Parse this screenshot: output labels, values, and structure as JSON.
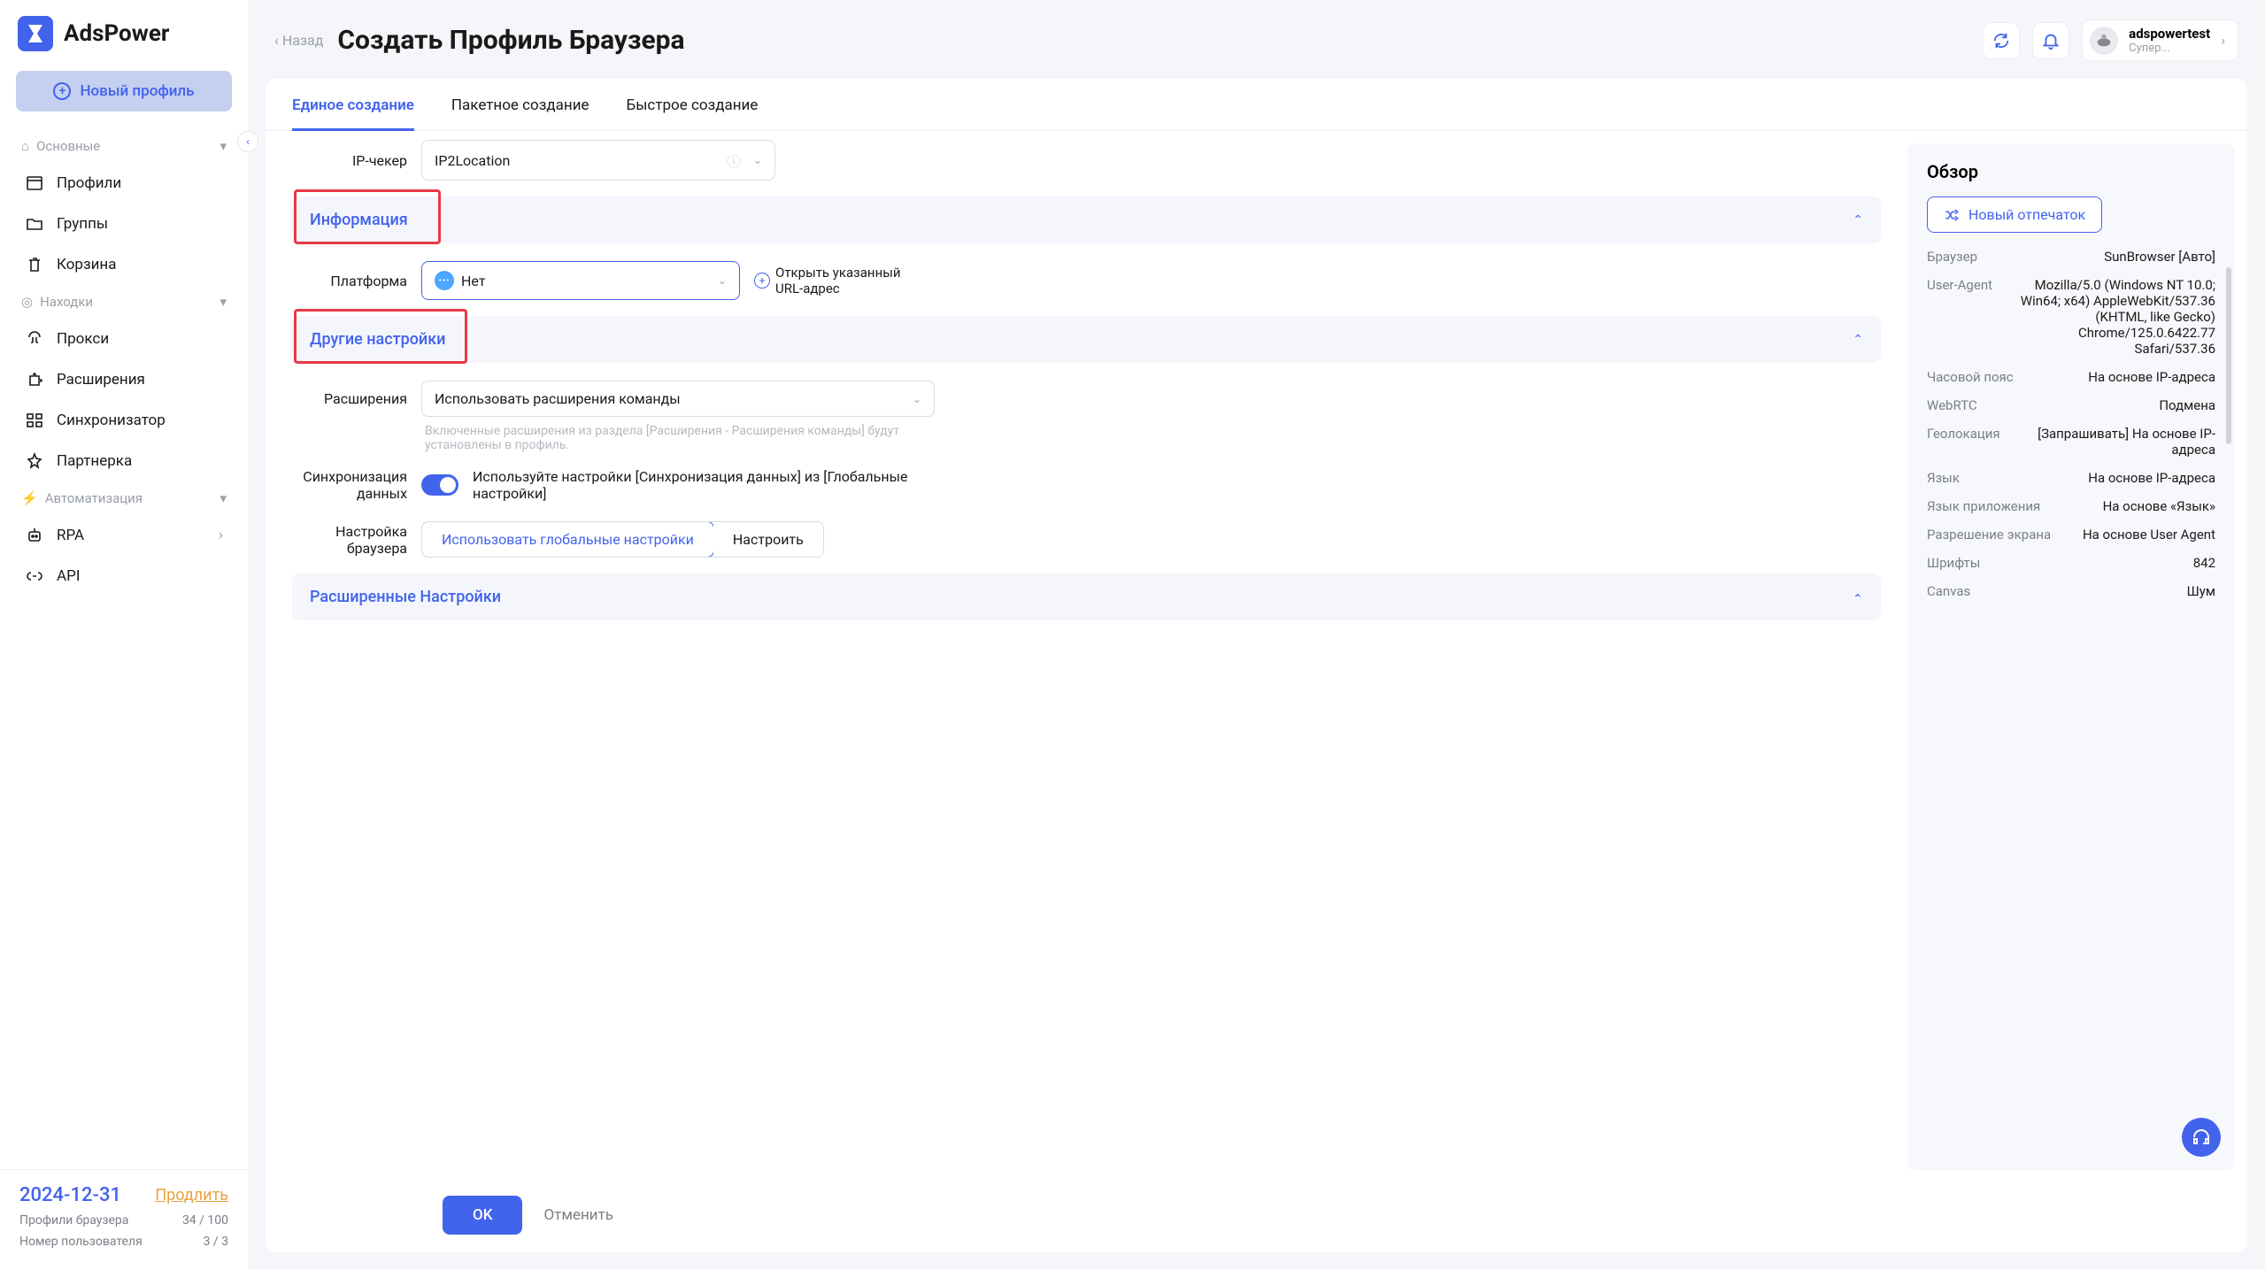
{
  "logo": {
    "text": "AdsPower"
  },
  "sidebar": {
    "new_profile": "Новый профиль",
    "sections": {
      "basic": {
        "label": "Основные",
        "items": [
          "Профили",
          "Группы",
          "Корзина"
        ]
      },
      "finds": {
        "label": "Находки",
        "items": [
          "Прокси",
          "Расширения",
          "Синхронизатор",
          "Партнерка"
        ]
      },
      "auto": {
        "label": "Автоматизация",
        "items": [
          "RPA",
          "API"
        ]
      }
    },
    "footer": {
      "date": "2024-12-31",
      "extend": "Продлить",
      "profiles_label": "Профили браузера",
      "profiles_value": "34 / 100",
      "users_label": "Номер пользователя",
      "users_value": "3 / 3"
    }
  },
  "header": {
    "back": "Назад",
    "title": "Создать Профиль Браузера",
    "user": {
      "name": "adspowertest",
      "role": "Супер..."
    }
  },
  "tabs": {
    "single": "Единое создание",
    "batch": "Пакетное создание",
    "quick": "Быстрое создание"
  },
  "form": {
    "ip_checker": {
      "label": "IP-чекер",
      "value": "IP2Location"
    },
    "section_info": "Информация",
    "platform": {
      "label": "Платформа",
      "value": "Нет",
      "open_url": "Открыть указанный URL-адрес"
    },
    "section_other": "Другие настройки",
    "extensions": {
      "label": "Расширения",
      "value": "Использовать расширения команды",
      "hint": "Включенные расширения из раздела [Расширения - Расширения команды] будут установлены в профиль."
    },
    "sync": {
      "label": "Синхронизация данных",
      "text": "Используйте настройки [Синхронизация данных] из [Глобальные настройки]"
    },
    "browser_settings": {
      "label": "Настройка браузера",
      "global": "Использовать глобальные настройки",
      "custom": "Настроить"
    },
    "section_advanced": "Расширенные Настройки"
  },
  "actions": {
    "ok": "OK",
    "cancel": "Отменить"
  },
  "overview": {
    "title": "Обзор",
    "new_fp": "Новый отпечаток",
    "rows": [
      {
        "k": "Браузер",
        "v": "SunBrowser [Авто]"
      },
      {
        "k": "User-Agent",
        "v": "Mozilla/5.0 (Windows NT 10.0; Win64; x64) AppleWebKit/537.36 (KHTML, like Gecko) Chrome/125.0.6422.77 Safari/537.36"
      },
      {
        "k": "Часовой пояс",
        "v": "На основе IP-адреса"
      },
      {
        "k": "WebRTC",
        "v": "Подмена"
      },
      {
        "k": "Геолокация",
        "v": "[Запрашивать] На основе IP-адреса"
      },
      {
        "k": "Язык",
        "v": "На основе IP-адреса"
      },
      {
        "k": "Язык приложения",
        "v": "На основе «Язык»"
      },
      {
        "k": "Разрешение экрана",
        "v": "На основе User Agent"
      },
      {
        "k": "Шрифты",
        "v": "842"
      },
      {
        "k": "Canvas",
        "v": "Шум"
      }
    ]
  }
}
